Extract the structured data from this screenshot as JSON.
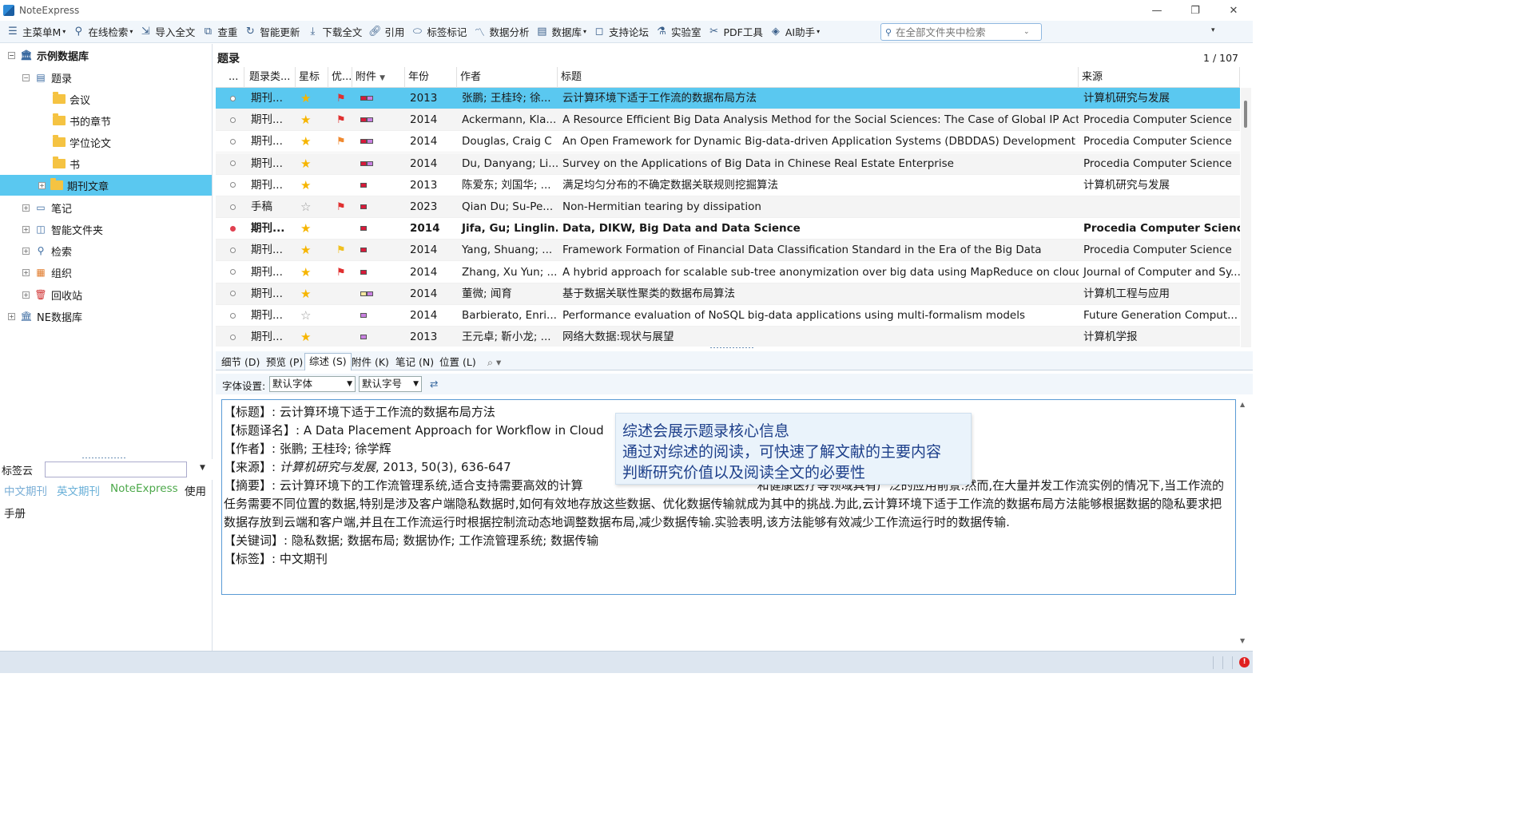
{
  "app": {
    "title": "NoteExpress"
  },
  "window_controls": {
    "minimize": "—",
    "maximize": "❐",
    "close": "✕"
  },
  "toolbar": {
    "items": [
      "主菜单M",
      "在线检索",
      "导入全文",
      "查重",
      "智能更新",
      "下载全文",
      "引用",
      "标签标记",
      "数据分析",
      "数据库",
      "支持论坛",
      "实验室",
      "PDF工具",
      "AI助手"
    ],
    "search_placeholder": "在全部文件夹中检索"
  },
  "tree": {
    "root": "示例数据库",
    "records": "题录",
    "folders": [
      "会议",
      "书的章节",
      "学位论文",
      "书",
      "期刊文章"
    ],
    "items": [
      "笔记",
      "智能文件夹",
      "检索",
      "组织",
      "回收站"
    ],
    "root2": "NE数据库"
  },
  "tagcloud": {
    "label": "标签云",
    "tags": [
      "中文期刊",
      "英文期刊",
      "NoteExpress",
      "使用",
      "手册"
    ],
    "tag_colors": [
      "#7aaed6",
      "#6ab0d8",
      "#4ca84a",
      "#222222",
      "#222222"
    ]
  },
  "main": {
    "title": "题录",
    "page": "1 / 107",
    "columns": [
      "...",
      "题录类...",
      "星标",
      "优...",
      "附件",
      "年份",
      "作者",
      "标题",
      "来源"
    ],
    "rows": [
      {
        "type": "期刊...",
        "starred": true,
        "flag": "red",
        "att": "rp",
        "year": "2013",
        "author": "张鹏; 王桂玲; 徐...",
        "title": "云计算环境下适于工作流的数据布局方法",
        "source": "计算机研究与发展",
        "read": true
      },
      {
        "type": "期刊...",
        "starred": true,
        "flag": "red",
        "att": "rp",
        "year": "2014",
        "author": "Ackermann, Kla...",
        "title": "A Resource Efficient Big Data Analysis Method for the Social Sciences: The Case of Global IP Activity",
        "source": "Procedia Computer Science",
        "read": true
      },
      {
        "type": "期刊...",
        "starred": true,
        "flag": "orange",
        "att": "rp",
        "year": "2014",
        "author": "Douglas, Craig C",
        "title": "An Open Framework for Dynamic Big-data-driven Application Systems (DBDDAS) Development",
        "source": "Procedia Computer Science",
        "read": true
      },
      {
        "type": "期刊...",
        "starred": true,
        "flag": "",
        "att": "rp",
        "year": "2014",
        "author": "Du, Danyang; Li...",
        "title": "Survey on the Applications of Big Data in Chinese Real Estate Enterprise",
        "source": "Procedia Computer Science",
        "read": true
      },
      {
        "type": "期刊...",
        "starred": true,
        "flag": "",
        "att": "r",
        "year": "2013",
        "author": "陈爱东; 刘国华; ...",
        "title": "满足均匀分布的不确定数据关联规则挖掘算法",
        "source": "计算机研究与发展",
        "read": true
      },
      {
        "type": "手稿",
        "starred": false,
        "flag": "red",
        "att": "r",
        "year": "2023",
        "author": "Qian Du; Su-Pe...",
        "title": "Non-Hermitian tearing by dissipation",
        "source": "",
        "read": true
      },
      {
        "type": "期刊...",
        "starred": true,
        "flag": "",
        "att": "r",
        "year": "2014",
        "author": "Jifa, Gu; Linglin...",
        "title": "Data, DIKW, Big Data and Data Science",
        "source": "Procedia Computer Science",
        "read": false
      },
      {
        "type": "期刊...",
        "starred": true,
        "flag": "yellow",
        "att": "r",
        "year": "2014",
        "author": "Yang, Shuang; ...",
        "title": "Framework Formation of Financial Data Classification Standard in the Era of the Big Data",
        "source": "Procedia Computer Science",
        "read": true
      },
      {
        "type": "期刊...",
        "starred": true,
        "flag": "red",
        "att": "r",
        "year": "2014",
        "author": "Zhang, Xu Yun; ...",
        "title": "A hybrid approach for scalable sub-tree anonymization over big data using MapReduce on cloud",
        "source": "Journal of Computer and Sy...",
        "read": true
      },
      {
        "type": "期刊...",
        "starred": true,
        "flag": "",
        "att": "yp",
        "year": "2014",
        "author": "董微; 闻育",
        "title": "基于数据关联性聚类的数据布局算法",
        "source": "计算机工程与应用",
        "read": true
      },
      {
        "type": "期刊...",
        "starred": false,
        "flag": "",
        "att": "p",
        "year": "2014",
        "author": "Barbierato, Enri...",
        "title": "Performance evaluation of NoSQL big-data applications using multi-formalism models",
        "source": "Future Generation Comput...",
        "read": true
      },
      {
        "type": "期刊...",
        "starred": true,
        "flag": "",
        "att": "p",
        "year": "2013",
        "author": "王元卓; 靳小龙; ...",
        "title": "网络大数据:现状与展望",
        "source": "计算机学报",
        "read": true
      }
    ]
  },
  "tabs": [
    "细节 (D)",
    "预览 (P)",
    "综述 (S)",
    "附件 (K)",
    "笔记 (N)",
    "位置 (L)"
  ],
  "fontsettings": {
    "label": "字体设置:",
    "font": "默认字体",
    "size": "默认字号"
  },
  "summary": {
    "title_label": "【标题】:",
    "title": "云计算环境下适于工作流的数据布局方法",
    "trans_label": "【标题译名】:",
    "trans": "A Data Placement Approach for Workflow in Cloud",
    "author_label": "【作者】:",
    "author": "张鹏; 王桂玲; 徐学辉",
    "source_label": "【来源】:",
    "source_journal": "计算机研究与发展",
    "source_rest": ", 2013, 50(3), 636-647",
    "abstract_label": "【摘要】:",
    "abstract_p1": "云计算环境下的工作流管理系统,适合支持需要高效的计算",
    "abstract_p1b": "和健康医疗等领域具有广泛的应用前景.然而,",
    "abstract_p2": "在大量并发工作流实例的情况下,当工作流的任务需要不同位置的数据,特别是涉及客户端隐私数据时,如何有效地存放这些数据、优化数据传输就成为其中的挑战.为此,云计算环境下适于工作流的数据布局方法能够根据数据的隐私要求把数据存放到云端和客户端,并且在工作流运行时根据控制流动态地调整数据布局,减少数据传输.实验表明,该方法能够有效减少工作流运行时的数据传输.",
    "keywords_label": "【关键词】:",
    "keywords": "隐私数据; 数据布局; 数据协作; 工作流管理系统; 数据传输",
    "tags_label": "【标签】:",
    "tags": "中文期刊"
  },
  "tooltip": {
    "line1": "综述会展示题录核心信息",
    "line2": "通过对综述的阅读，可快速了解文献的主要内容",
    "line3": "判断研究价值以及阅读全文的必要性"
  },
  "status": {
    "error_mark": "!"
  }
}
